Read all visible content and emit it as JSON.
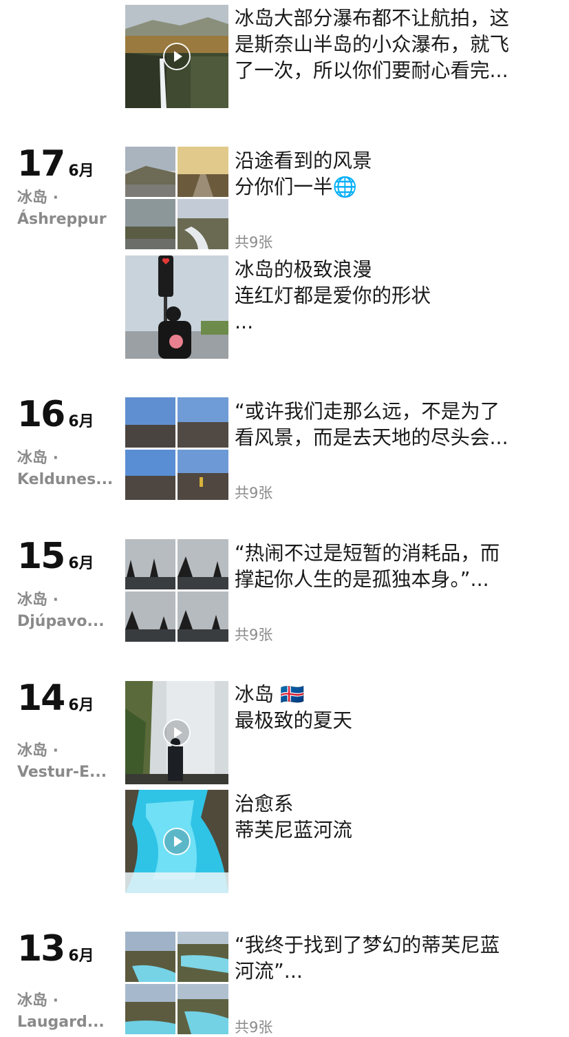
{
  "entries": [
    {
      "caption": [
        "冰岛大部分瀑布都不让航拍，这",
        "是斯奈山半岛的小众瀑布，就飞",
        "了一次，所以你们要耐心看完..."
      ]
    },
    {
      "day": "17",
      "month": "6月",
      "loc1": "冰岛 ·",
      "loc2": "Áshreppur",
      "caption": [
        "沿途看到的风景",
        "分你们一半🌐"
      ],
      "count": "共9张"
    },
    {
      "caption": [
        "冰岛的极致浪漫",
        "连红灯都是爱你的形状",
        "..."
      ]
    },
    {
      "day": "16",
      "month": "6月",
      "loc1": "冰岛 ·",
      "loc2": "Keldunes...",
      "caption": [
        "“或许我们走那么远，不是为了",
        "看风景，而是去天地的尽头会..."
      ],
      "count": "共9张"
    },
    {
      "day": "15",
      "month": "6月",
      "loc1": "冰岛 ·",
      "loc2": "Djúpavo...",
      "caption": [
        "“热闹不过是短暂的消耗品，而",
        "撑起你人生的是孤独本身。”..."
      ],
      "count": "共9张"
    },
    {
      "day": "14",
      "month": "6月",
      "loc1": "冰岛 ·",
      "loc2": "Vestur-E...",
      "caption": [
        "冰岛 🇮🇸",
        "最极致的夏天"
      ]
    },
    {
      "caption": [
        "治愈系",
        "蒂芙尼蓝河流"
      ]
    },
    {
      "day": "13",
      "month": "6月",
      "loc1": "冰岛 ·",
      "loc2": "Laugard...",
      "caption": [
        "“我终于找到了梦幻的蒂芙尼蓝",
        "河流”..."
      ],
      "count": "共9张"
    }
  ],
  "icons": {
    "play": "play-icon"
  }
}
